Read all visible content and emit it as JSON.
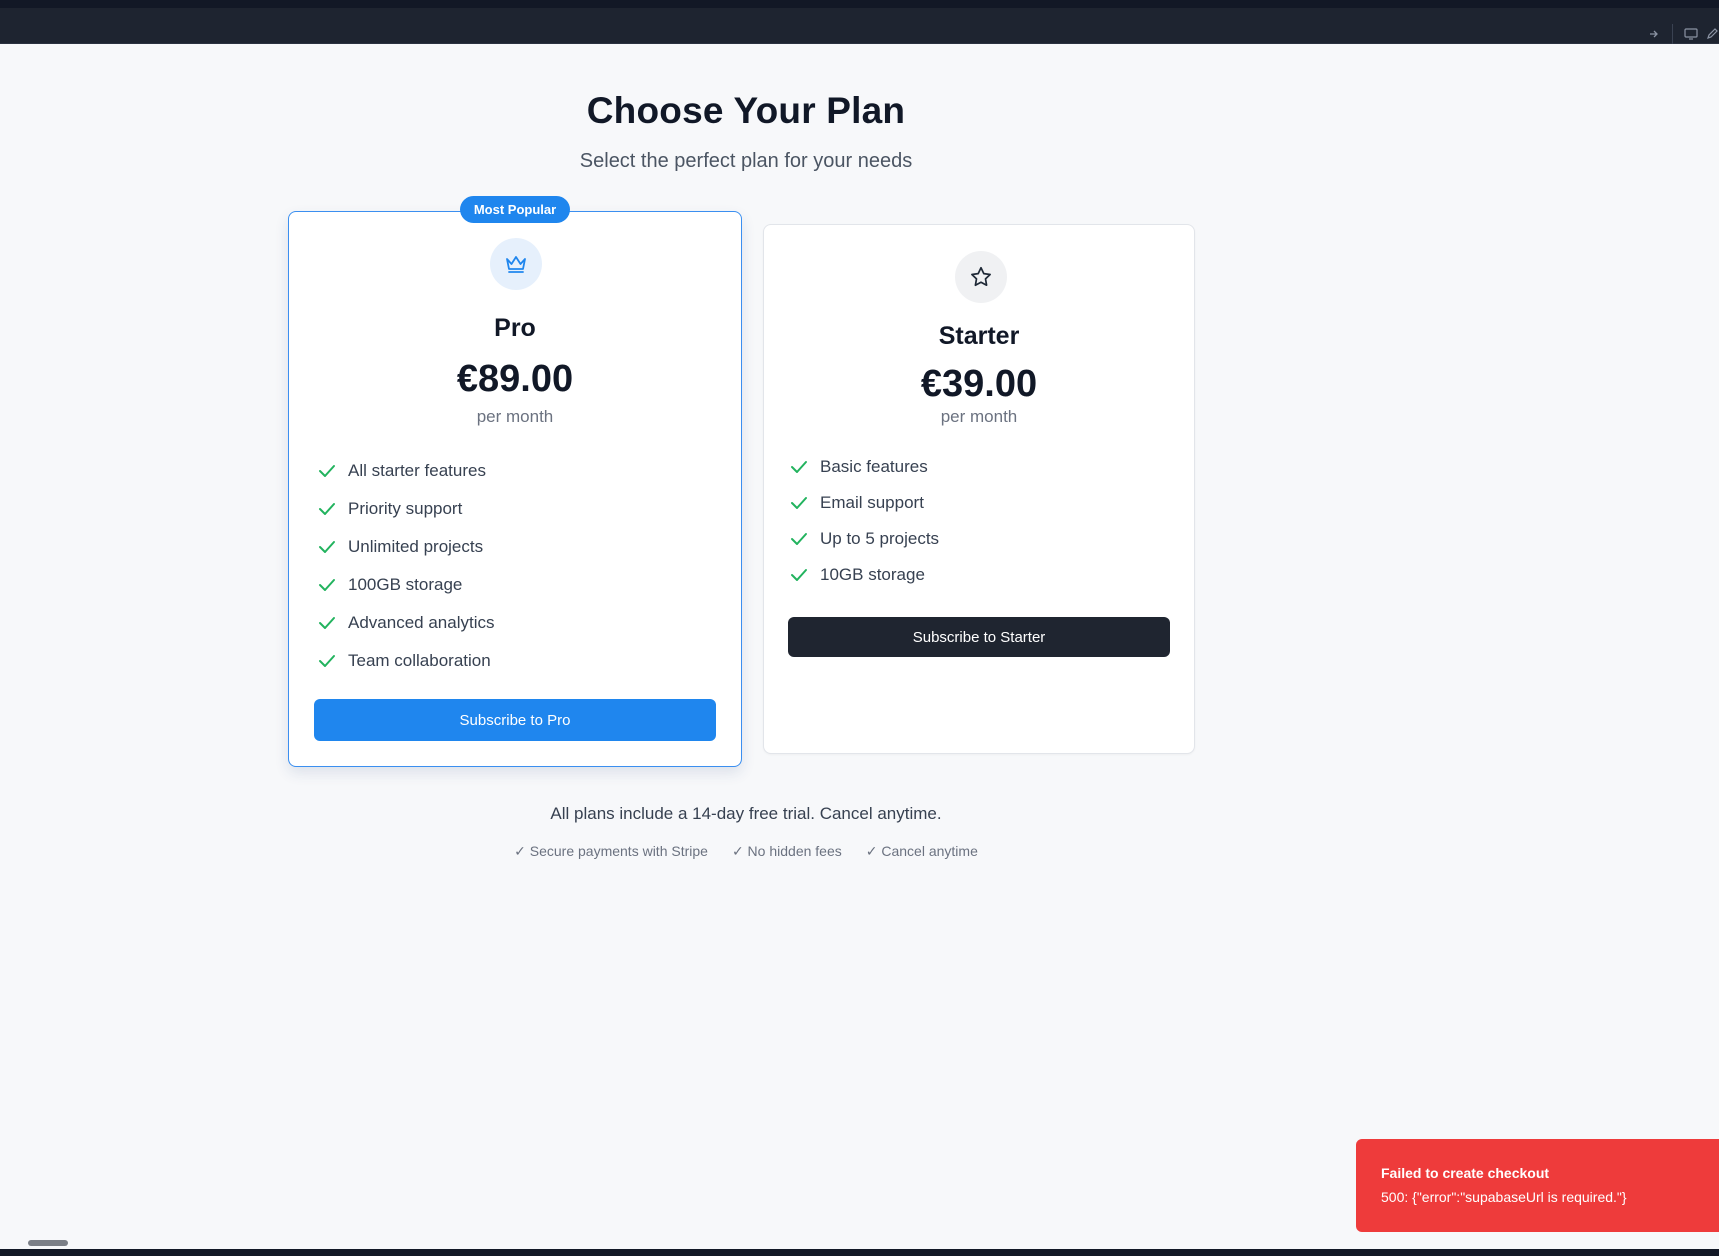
{
  "header": {
    "title": "Choose Your Plan",
    "subtitle": "Select the perfect plan for your needs"
  },
  "plans": [
    {
      "name": "Pro",
      "badge": "Most Popular",
      "icon": "crown-icon",
      "price": "€89.00",
      "period": "per month",
      "features": [
        "All starter features",
        "Priority support",
        "Unlimited projects",
        "100GB storage",
        "Advanced analytics",
        "Team collaboration"
      ],
      "button_label": "Subscribe to Pro",
      "accent": "#1f86ee"
    },
    {
      "name": "Starter",
      "icon": "star-icon",
      "price": "€39.00",
      "period": "per month",
      "features": [
        "Basic features",
        "Email support",
        "Up to 5 projects",
        "10GB storage"
      ],
      "button_label": "Subscribe to Starter",
      "accent": "#1f2530"
    }
  ],
  "footer": {
    "note": "All plans include a 14-day free trial. Cancel anytime.",
    "badges": [
      "✓ Secure payments with Stripe",
      "✓ No hidden fees",
      "✓ Cancel anytime"
    ]
  },
  "toast": {
    "title": "Failed to create checkout",
    "message": "500: {\"error\":\"supabaseUrl is required.\"}",
    "color": "#ee3b3b"
  },
  "colors": {
    "check": "#22b35e",
    "background": "#f7f8fa"
  }
}
